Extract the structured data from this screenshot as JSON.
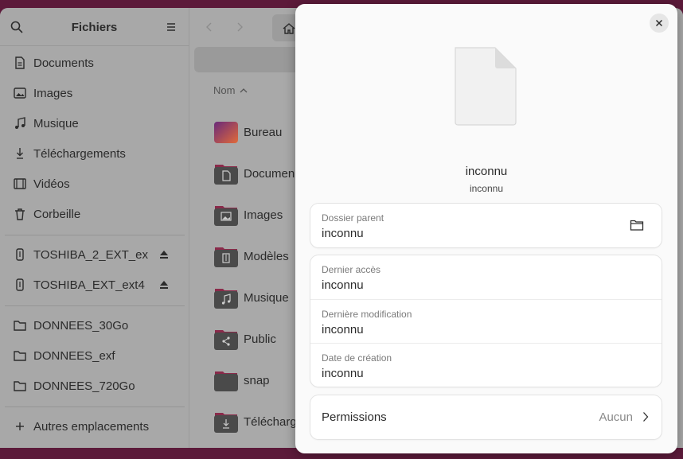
{
  "sidebar": {
    "title": "Fichiers",
    "items": [
      {
        "label": "Documents",
        "icon": "document-icon"
      },
      {
        "label": "Images",
        "icon": "image-icon"
      },
      {
        "label": "Musique",
        "icon": "music-icon"
      },
      {
        "label": "Téléchargements",
        "icon": "download-icon"
      },
      {
        "label": "Vidéos",
        "icon": "video-icon"
      },
      {
        "label": "Corbeille",
        "icon": "trash-icon"
      }
    ],
    "drives": [
      {
        "label": "TOSHIBA_2_EXT_ex"
      },
      {
        "label": "TOSHIBA_EXT_ext4"
      }
    ],
    "bookmarks": [
      {
        "label": "DONNEES_30Go"
      },
      {
        "label": "DONNEES_exf"
      },
      {
        "label": "DONNEES_720Go"
      }
    ],
    "other_locations": "Autres emplacements"
  },
  "main": {
    "column_name": "Nom",
    "files": [
      {
        "label": "Bureau"
      },
      {
        "label": "Documen"
      },
      {
        "label": "Images"
      },
      {
        "label": "Modèles"
      },
      {
        "label": "Musique"
      },
      {
        "label": "Public"
      },
      {
        "label": "snap"
      },
      {
        "label": "Télécharg"
      }
    ]
  },
  "dialog": {
    "file_name": "inconnu",
    "file_type": "inconnu",
    "parent": {
      "label": "Dossier parent",
      "value": "inconnu"
    },
    "dates": [
      {
        "label": "Dernier accès",
        "value": "inconnu"
      },
      {
        "label": "Dernière modification",
        "value": "inconnu"
      },
      {
        "label": "Date de création",
        "value": "inconnu"
      }
    ],
    "permissions": {
      "label": "Permissions",
      "value": "Aucun"
    }
  },
  "colors": {
    "accent_folder": "#4a4a4a",
    "folder_tab": "#8a2a4a",
    "desktop_bg": "#5c1a3a"
  }
}
